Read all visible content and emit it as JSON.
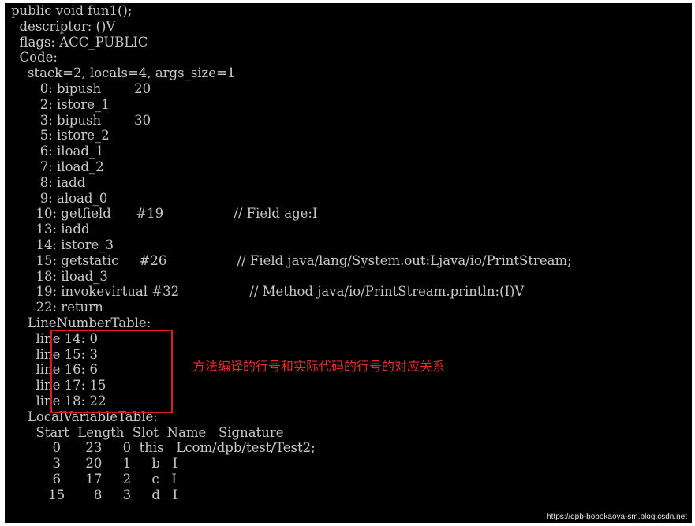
{
  "console": {
    "lines": [
      "public void fun1();",
      "  descriptor: ()V",
      "  flags: ACC_PUBLIC",
      "  Code:",
      "    stack=2, locals=4, args_size=1",
      "       0: bipush        20",
      "       2: istore_1",
      "       3: bipush        30",
      "       5: istore_2",
      "       6: iload_1",
      "       7: iload_2",
      "       8: iadd",
      "       9: aload_0",
      "      10: getfield      #19                 // Field age:I",
      "      13: iadd",
      "      14: istore_3",
      "      15: getstatic     #26                 // Field java/lang/System.out:Ljava/io/PrintStream;",
      "      18: iload_3",
      "      19: invokevirtual #32                 // Method java/io/PrintStream.println:(I)V",
      "      22: return",
      "    LineNumberTable:",
      "      line 14: 0",
      "      line 15: 3",
      "      line 16: 6",
      "      line 17: 15",
      "      line 18: 22",
      "    LocalVariableTable:",
      "      Start  Length  Slot  Name   Signature",
      "          0      23     0  this   Lcom/dpb/test/Test2;",
      "          3      20     1     b   I",
      "          6      17     2     c   I",
      "         15       8     3     d   I"
    ]
  },
  "annotation": {
    "text": "方法编译的行号和实际代码的行号的对应关系",
    "color": "#e0302b"
  },
  "highlight_color": "#d91e1e",
  "watermark": "https://dpb-bobokaoya-sm.blog.csdn.net"
}
